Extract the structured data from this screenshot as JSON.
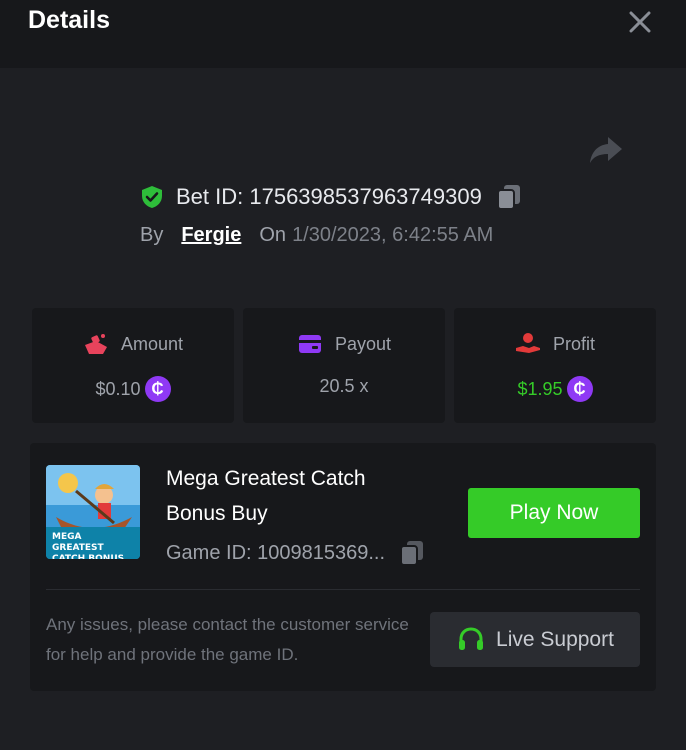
{
  "header": {
    "title": "Details"
  },
  "bet": {
    "id_text": "Bet ID: 1756398537963749309",
    "by_label": "By",
    "username": "Fergie",
    "on_label": "On",
    "datetime": "1/30/2023, 6:42:55 AM"
  },
  "stats": {
    "amount": {
      "label": "Amount",
      "value": "$0.10",
      "coin": "₵"
    },
    "payout": {
      "label": "Payout",
      "value": "20.5 x"
    },
    "profit": {
      "label": "Profit",
      "value": "$1.95",
      "coin": "₵"
    }
  },
  "game": {
    "name": "Mega Greatest Catch Bonus Buy",
    "thumb_text": "Mega Greatest Catch Bonus Buy",
    "id_text": "Game ID: 1009815369...",
    "play_label": "Play Now"
  },
  "support": {
    "message": "Any issues, please contact the customer service for help and provide the game ID.",
    "button_label": "Live Support"
  },
  "colors": {
    "accent_green": "#35cb28",
    "coin_purple": "#8f39f5",
    "amount_icon": "#e8435c",
    "payout_icon": "#8f39f5",
    "profit_icon": "#e23a3a",
    "shield_green": "#2ebd3a"
  },
  "icons": {
    "close": "close-icon",
    "share": "share-icon",
    "shield": "shield-check-icon",
    "copy": "copy-icon",
    "amount": "amount-icon",
    "payout": "wallet-icon",
    "profit": "profit-icon",
    "support": "headset-icon"
  }
}
